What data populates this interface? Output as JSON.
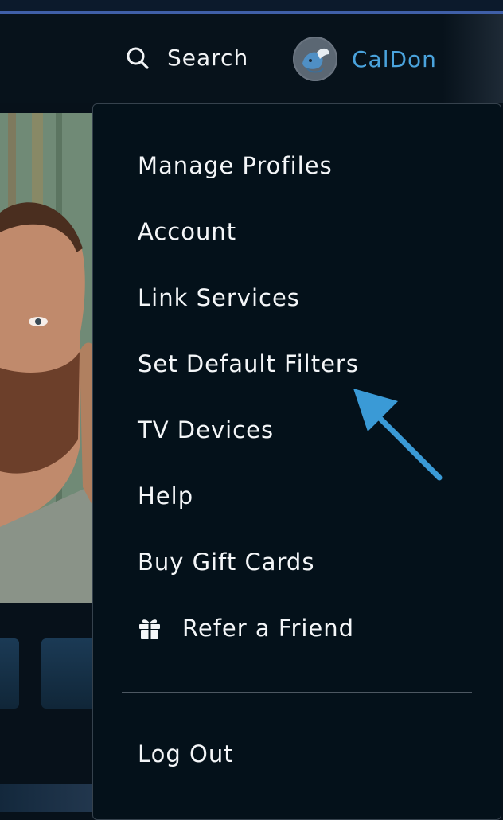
{
  "header": {
    "search_label": "Search",
    "profile_name": "CalDon"
  },
  "menu": {
    "items": [
      {
        "label": "Manage Profiles"
      },
      {
        "label": "Account"
      },
      {
        "label": "Link Services"
      },
      {
        "label": "Set Default Filters"
      },
      {
        "label": "TV Devices"
      },
      {
        "label": "Help"
      },
      {
        "label": "Buy Gift Cards"
      },
      {
        "label": "Refer a Friend",
        "icon": "gift-icon"
      }
    ],
    "logout_label": "Log Out"
  },
  "annotation": {
    "arrow_color": "#3a9ad6",
    "points_to": "Set Default Filters"
  },
  "colors": {
    "accent": "#4aa3dd",
    "menu_bg": "#04111a",
    "text": "#f4f6f8"
  }
}
